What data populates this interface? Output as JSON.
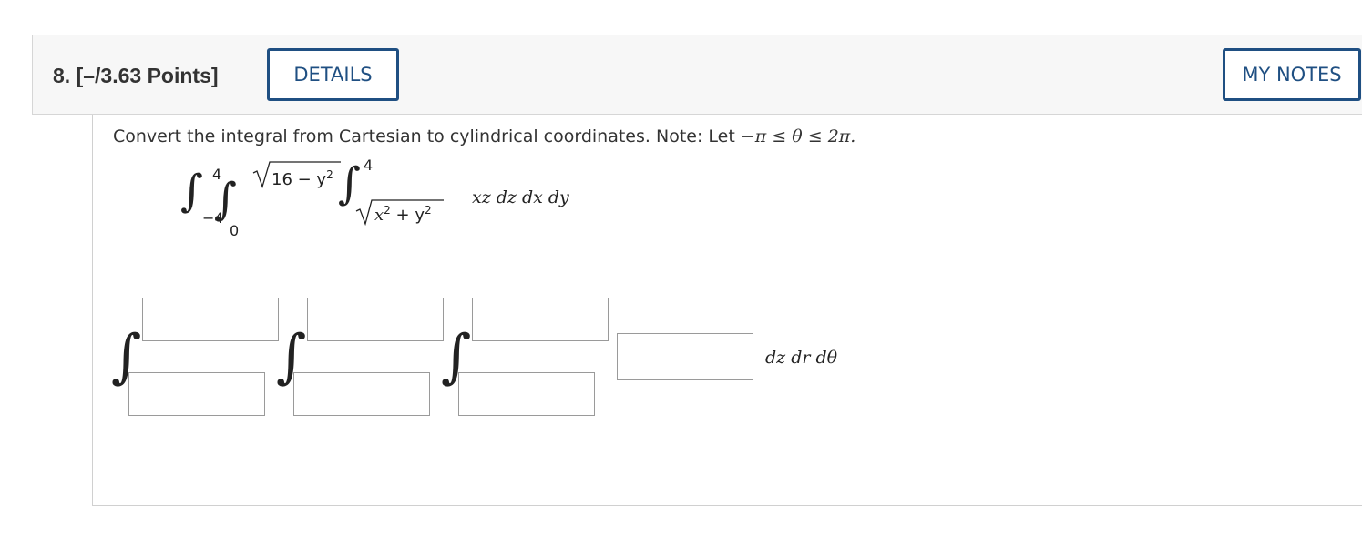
{
  "question": {
    "number": "8.",
    "points": "[–/3.63 Points]",
    "details_label": "DETAILS",
    "my_notes_label": "MY NOTES"
  },
  "prompt": {
    "text": "Convert the integral from Cartesian to cylindrical coordinates. Note: Let",
    "condition": "−π ≤ θ ≤ 2π."
  },
  "given_integral": {
    "outer_lower": "−4",
    "outer_upper": "4",
    "middle_lower": "0",
    "middle_upper": "16 − y",
    "middle_upper_exp": "2",
    "inner_upper": "4",
    "inner_lower": "x",
    "inner_lower_exp1": "2",
    "inner_lower_mid": " + y",
    "inner_lower_exp2": "2",
    "integrand": "xz dz dx dy"
  },
  "answer": {
    "differentials": "dz dr dθ",
    "fields": {
      "outer_upper": "",
      "outer_lower": "",
      "middle_upper": "",
      "middle_lower": "",
      "inner_upper": "",
      "inner_lower": "",
      "integrand": ""
    }
  }
}
